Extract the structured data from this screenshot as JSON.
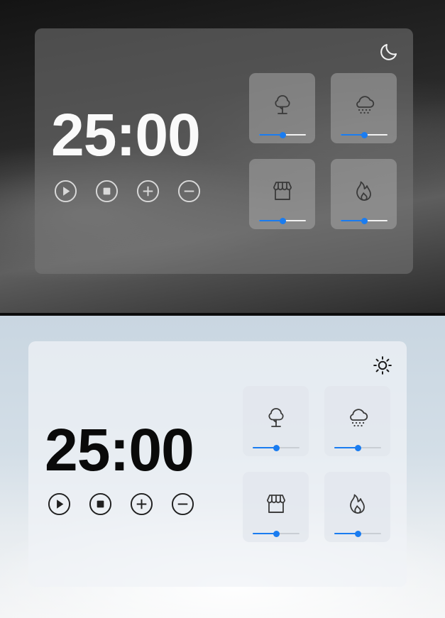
{
  "panels": [
    {
      "theme": "dark",
      "timer": "25:00",
      "mode_icon": "moon-icon",
      "controls": [
        "play-icon",
        "stop-icon",
        "plus-icon",
        "minus-icon"
      ],
      "sounds": [
        {
          "name": "tree-icon",
          "volume": 0.5
        },
        {
          "name": "snow-cloud-icon",
          "volume": 0.5
        },
        {
          "name": "store-icon",
          "volume": 0.5
        },
        {
          "name": "fire-icon",
          "volume": 0.5
        }
      ]
    },
    {
      "theme": "light",
      "timer": "25:00",
      "mode_icon": "sun-icon",
      "controls": [
        "play-icon",
        "stop-icon",
        "plus-icon",
        "minus-icon"
      ],
      "sounds": [
        {
          "name": "tree-icon",
          "volume": 0.5
        },
        {
          "name": "snow-cloud-icon",
          "volume": 0.5
        },
        {
          "name": "store-icon",
          "volume": 0.5
        },
        {
          "name": "fire-icon",
          "volume": 0.5
        }
      ]
    }
  ],
  "colors": {
    "accent": "#1a7cf0",
    "dark_icon": "#d6d6d6",
    "light_icon": "#222222",
    "tile_icon_dark": "#3a3a3a",
    "tile_icon_light": "#3a3a3a"
  }
}
